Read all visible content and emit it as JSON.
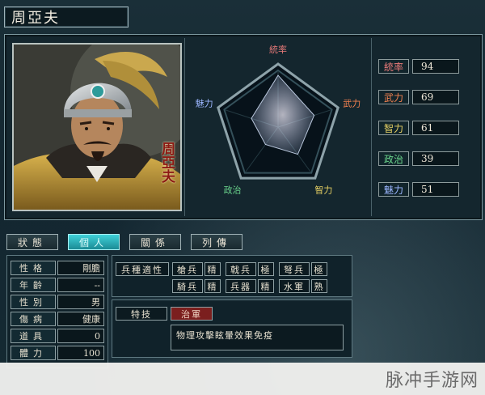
{
  "officer": {
    "name": "周亞夫",
    "portrait_text": "周亞夫"
  },
  "radar": {
    "axes": [
      "統率",
      "武力",
      "智力",
      "政治",
      "魅力"
    ],
    "values": [
      94,
      69,
      61,
      39,
      51
    ],
    "max": 100
  },
  "stats": [
    {
      "label": "統率",
      "value": "94",
      "color": "#e87a79"
    },
    {
      "label": "武力",
      "value": "69",
      "color": "#f0804f"
    },
    {
      "label": "智力",
      "value": "61",
      "color": "#e6d063"
    },
    {
      "label": "政治",
      "value": "39",
      "color": "#6ad48c"
    },
    {
      "label": "魅力",
      "value": "51",
      "color": "#9bb6ff"
    }
  ],
  "tabs": [
    "狀態",
    "個人",
    "關係",
    "列傳"
  ],
  "active_tab": "個人",
  "info": [
    {
      "k": "性格",
      "v": "剛膽"
    },
    {
      "k": "年齡",
      "v": "--"
    },
    {
      "k": "性別",
      "v": "男"
    },
    {
      "k": "傷病",
      "v": "健康"
    },
    {
      "k": "道具",
      "v": "0"
    },
    {
      "k": "體力",
      "v": "100"
    }
  ],
  "troops": {
    "label": "兵種適性",
    "row1": [
      {
        "k": "槍兵",
        "v": "精"
      },
      {
        "k": "戟兵",
        "v": "極"
      },
      {
        "k": "弩兵",
        "v": "極"
      }
    ],
    "row2": [
      {
        "k": "騎兵",
        "v": "精"
      },
      {
        "k": "兵器",
        "v": "精"
      },
      {
        "k": "水軍",
        "v": "熟"
      }
    ]
  },
  "skill": {
    "label": "特技",
    "name": "治軍",
    "description": "物理攻擊眩暈效果免疫"
  },
  "watermark": "脉冲手游网"
}
